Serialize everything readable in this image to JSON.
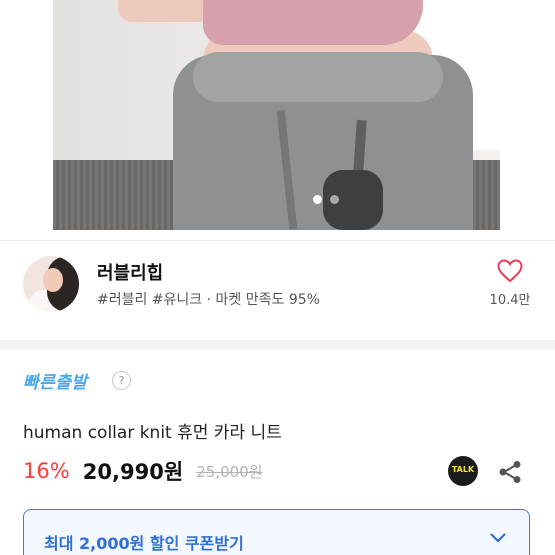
{
  "gallery": {
    "slide_count": 2,
    "active_index": 0
  },
  "shop": {
    "name": "러블리힙",
    "tags": "#러블리 #유니크 · 마켓 만족도 95%",
    "likes": "10.4만",
    "heart_color": "#e6405a"
  },
  "product": {
    "fast_delivery": "빠른출발",
    "help": "?",
    "title": "human collar knit 휴먼 카라 니트",
    "discount": "16%",
    "price": "20,990원",
    "original_price": "25,000원",
    "talk_label": "TALK"
  },
  "coupon": {
    "label": "최대 2,000원 할인 쿠폰받기",
    "accent": "#3e7be0"
  },
  "icons": [
    "heart-icon",
    "help-icon",
    "kakao-talk-icon",
    "share-icon",
    "chevron-down-icon"
  ]
}
